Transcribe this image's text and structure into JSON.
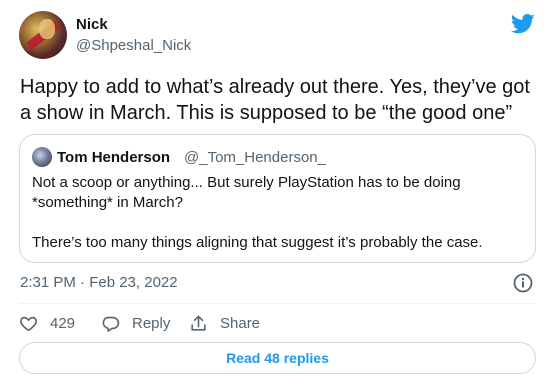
{
  "author": {
    "name": "Nick",
    "handle": "@Shpeshal_Nick",
    "avatar_icon": "user-avatar"
  },
  "brand": {
    "logo_icon": "twitter-bird-icon",
    "color": "#1d9bf0"
  },
  "tweet": {
    "text": "Happy to add to what’s already out there. Yes, they’ve got a show in March. This is supposed to be “the good one”"
  },
  "quoted_tweet": {
    "author_name": "Tom Henderson",
    "author_handle": "@_Tom_Henderson_",
    "text_line1": "Not a scoop or anything... But surely PlayStation has to be doing *something* in March?",
    "text_line2": "There’s too many things aligning that suggest it’s probably the case."
  },
  "meta": {
    "timestamp": "2:31 PM · Feb 23, 2022",
    "info_icon": "info-icon"
  },
  "actions": {
    "like_count": "429",
    "reply_label": "Reply",
    "share_label": "Share"
  },
  "replies": {
    "label": "Read 48 replies"
  },
  "colors": {
    "text": "#0f1419",
    "secondary": "#536471",
    "border": "#cfd9de"
  }
}
